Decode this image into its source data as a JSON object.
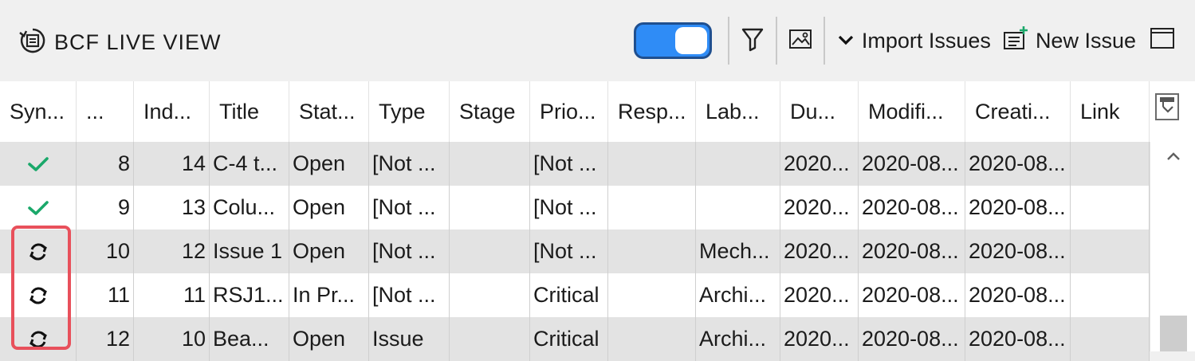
{
  "panel": {
    "title": "BCF LIVE VIEW"
  },
  "toolbar": {
    "import_label": "Import Issues",
    "new_issue_label": "New Issue",
    "toggle_on": true,
    "accent_color": "#2f8cf6"
  },
  "icons": {
    "panel": "bcf-live-view-icon",
    "filter": "filter-icon",
    "snapshot": "image-icon",
    "chevron": "chevron-down-icon",
    "new_issue": "new-issue-icon",
    "restore": "window-restore-icon",
    "synced": "checkmark-icon",
    "pending": "sync-icon",
    "column_chooser": "column-chooser-icon",
    "scroll_up": "scroll-up-icon"
  },
  "table": {
    "columns": [
      "Syn...",
      "...",
      "Ind...",
      "Title",
      "Stat...",
      "Type",
      "Stage",
      "Prio...",
      "Resp...",
      "Lab...",
      "Du...",
      "Modifi...",
      "Creati...",
      "Link"
    ],
    "rows": [
      {
        "sync": "synced",
        "no": "8",
        "index": "14",
        "title": "C-4 t...",
        "status": "Open",
        "type": "[Not ...",
        "stage": "",
        "priority": "[Not ...",
        "responsible": "",
        "label": "",
        "due": "2020...",
        "modified": "2020-08...",
        "created": "2020-08...",
        "link": ""
      },
      {
        "sync": "synced",
        "no": "9",
        "index": "13",
        "title": "Colu...",
        "status": "Open",
        "type": "[Not ...",
        "stage": "",
        "priority": "[Not ...",
        "responsible": "",
        "label": "",
        "due": "2020...",
        "modified": "2020-08...",
        "created": "2020-08...",
        "link": ""
      },
      {
        "sync": "pending",
        "no": "10",
        "index": "12",
        "title": "Issue 1",
        "status": "Open",
        "type": "[Not ...",
        "stage": "",
        "priority": "[Not ...",
        "responsible": "",
        "label": "Mech...",
        "due": "2020...",
        "modified": "2020-08...",
        "created": "2020-08...",
        "link": ""
      },
      {
        "sync": "pending",
        "no": "11",
        "index": "11",
        "title": "RSJ1...",
        "status": "In Pr...",
        "type": "[Not ...",
        "stage": "",
        "priority": "Critical",
        "responsible": "",
        "label": "Archi...",
        "due": "2020...",
        "modified": "2020-08...",
        "created": "2020-08...",
        "link": ""
      },
      {
        "sync": "pending",
        "no": "12",
        "index": "10",
        "title": "Bea...",
        "status": "Open",
        "type": "Issue",
        "stage": "",
        "priority": "Critical",
        "responsible": "",
        "label": "Archi...",
        "due": "2020...",
        "modified": "2020-08...",
        "created": "2020-08...",
        "link": ""
      }
    ]
  },
  "colors": {
    "check": "#1aa86a",
    "highlight": "#e8505b",
    "row_alt": "#e3e3e3"
  }
}
